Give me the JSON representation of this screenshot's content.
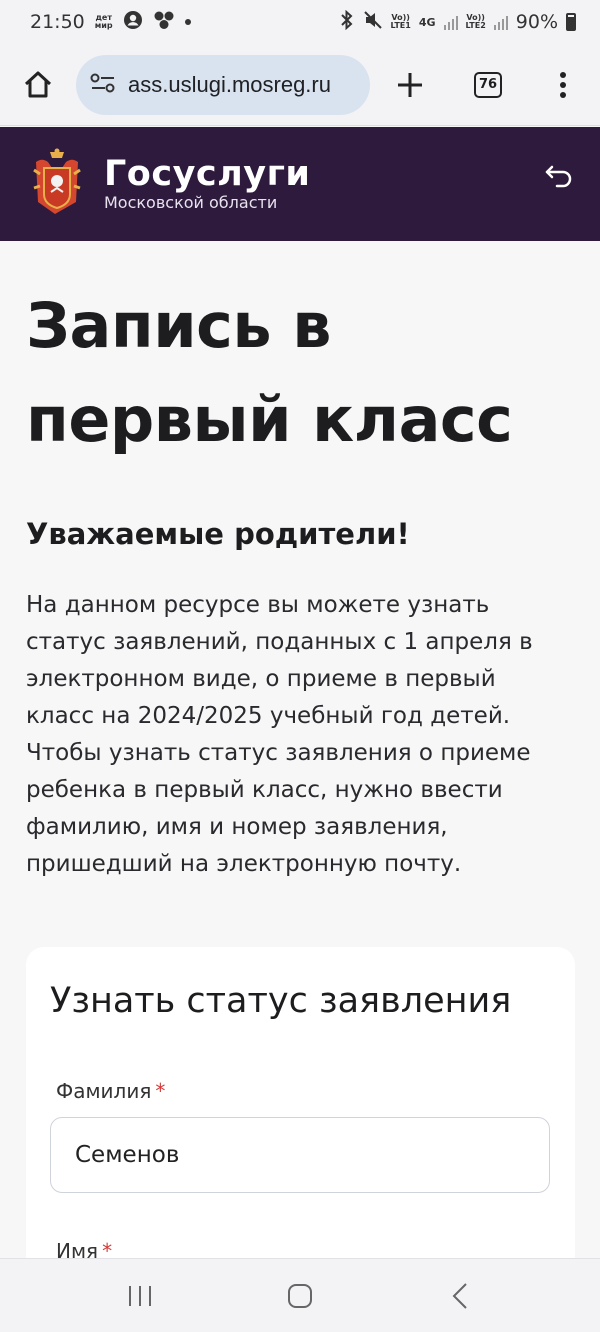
{
  "status_bar": {
    "time": "21:50",
    "app_badge_line1": "дет",
    "app_badge_line2": "мир",
    "sim1": "LTE1",
    "network": "4G",
    "sim2": "LTE2",
    "volte": "Vo))",
    "battery": "90%"
  },
  "browser": {
    "url": "ass.uslugi.mosreg.ru",
    "tab_count": "76"
  },
  "header": {
    "brand_name": "Госуслуги",
    "brand_sub": "Московской области"
  },
  "page": {
    "title": "Запись в первый класс",
    "section_title": "Уважаемые родители!",
    "intro": "На данном ресурсе вы можете узнать статус заявлений, поданных с 1 апреля в электронном виде, о приеме в первый класс на 2024/2025 учебный год детей. Чтобы узнать статус заявления о приеме ребенка в первый класс, нужно ввести фамилию, имя и номер заявления, пришедший на электронную почту."
  },
  "form": {
    "title": "Узнать статус заявления",
    "surname_label": "Фамилия",
    "surname_value": "Семенов",
    "name_label": "Имя",
    "required_mark": "*"
  },
  "colors": {
    "header_bg": "#2d1a3d",
    "required": "#d23b3b",
    "url_bg": "#d9e3ef"
  }
}
